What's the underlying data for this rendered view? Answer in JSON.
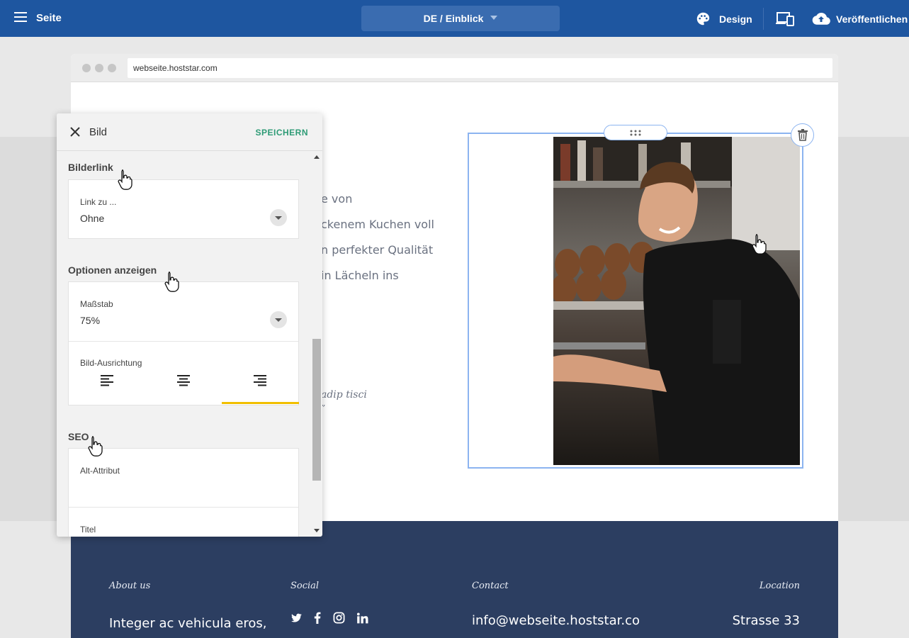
{
  "topbar": {
    "page_label": "Seite",
    "language_page": "DE / Einblick",
    "design_label": "Design",
    "publish_label": "Veröffentlichen"
  },
  "browser": {
    "url": "webseite.hoststar.com"
  },
  "content": {
    "lines": [
      "e von",
      "ckenem Kuchen voll",
      "n perfekter Qualität",
      "in Lächeln ins"
    ],
    "quote": "adip tisci",
    "quote_mark": "”"
  },
  "footer": {
    "about_heading": "About us",
    "about_text": "Integer ac vehicula eros,",
    "social_heading": "Social",
    "contact_heading": "Contact",
    "contact_email": "info@webseite.hoststar.co",
    "location_heading": "Location",
    "location_text": "Strasse 33"
  },
  "panel": {
    "title": "Bild",
    "save_label": "SPEICHERN",
    "bilderlink": {
      "heading": "Bilderlink",
      "link_label": "Link zu ...",
      "link_value": "Ohne"
    },
    "options": {
      "heading": "Optionen anzeigen",
      "scale_label": "Maßstab",
      "scale_value": "75%",
      "alignment_label": "Bild-Ausrichtung",
      "alignment_selected": "right"
    },
    "seo": {
      "heading": "SEO",
      "alt_label": "Alt-Attribut",
      "title_label": "Titel"
    }
  },
  "colors": {
    "topbar": "#1e56a0",
    "accent_save": "#2e9b76",
    "alignment_active": "#f1bf00",
    "footer": "#2c3e61",
    "selection": "#8cb4f0"
  }
}
